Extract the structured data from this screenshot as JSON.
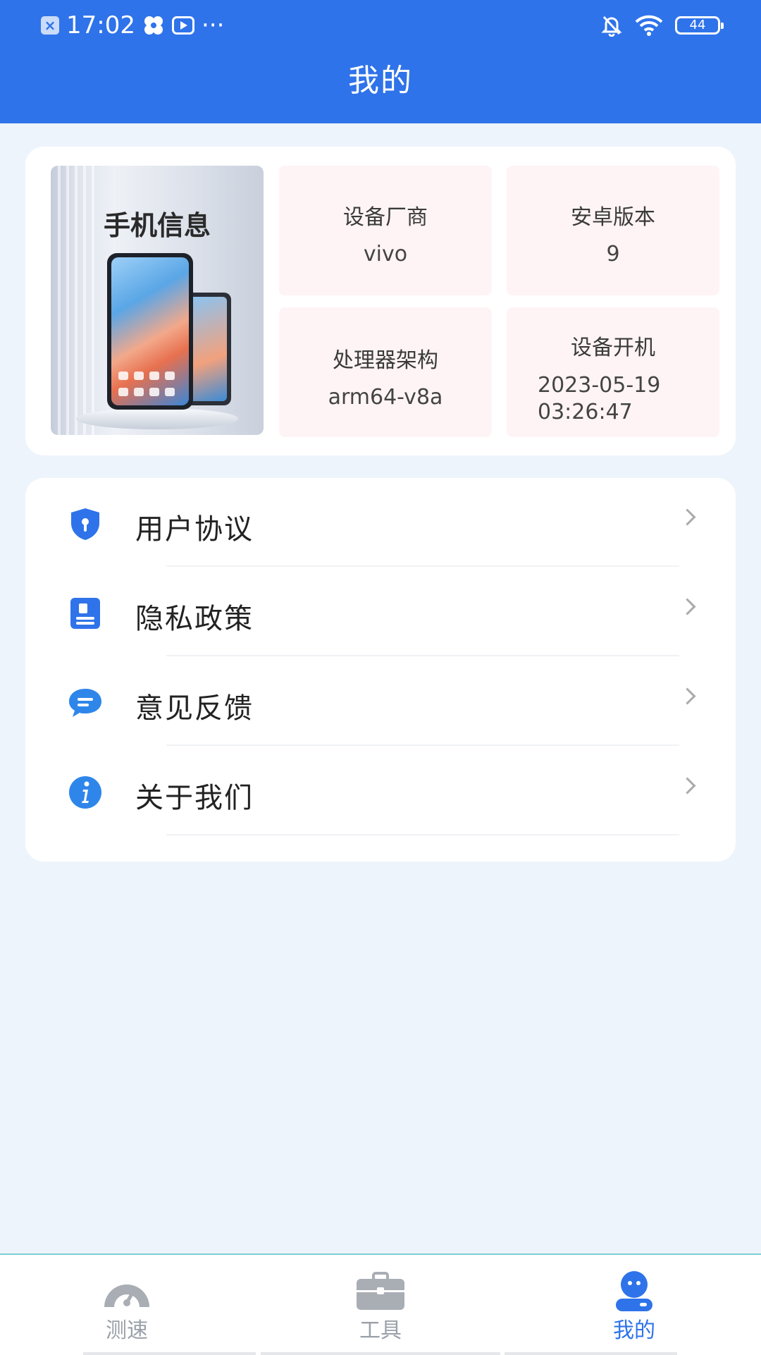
{
  "status_bar": {
    "time": "17:02",
    "dots": "···",
    "battery": "44",
    "left_icons": [
      "notification-x-icon",
      "fan-icon",
      "video-icon"
    ],
    "right_icons": [
      "bell-off-icon",
      "wifi-icon",
      "battery-icon"
    ]
  },
  "header": {
    "title": "我的"
  },
  "phone_info": {
    "title": "手机信息",
    "stats": [
      {
        "label": "设备厂商",
        "value": "vivo"
      },
      {
        "label": "安卓版本",
        "value": "9"
      },
      {
        "label": "处理器架构",
        "value": "arm64-v8a"
      },
      {
        "label": "设备开机",
        "value_line1": "2023-05-19",
        "value_line2": "03:26:47"
      }
    ]
  },
  "menu": [
    {
      "label": "用户协议",
      "icon": "shield-icon"
    },
    {
      "label": "隐私政策",
      "icon": "document-icon"
    },
    {
      "label": "意见反馈",
      "icon": "chat-bubble-icon"
    },
    {
      "label": "关于我们",
      "icon": "info-icon"
    }
  ],
  "bottom_nav": {
    "items": [
      {
        "label": "测速",
        "icon": "speedometer-icon",
        "active": false
      },
      {
        "label": "工具",
        "icon": "toolbox-icon",
        "active": false
      },
      {
        "label": "我的",
        "icon": "profile-icon",
        "active": true
      }
    ]
  },
  "colors": {
    "primary": "#2f73ea",
    "background": "#eef4fb",
    "stat_tile": "#fff4f5",
    "inactive_nav": "#9aa0a8"
  }
}
